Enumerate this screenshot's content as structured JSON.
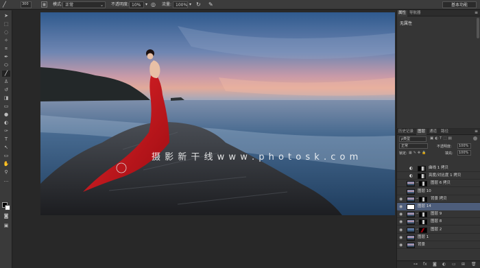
{
  "options_bar": {
    "brush_size": "300",
    "mode_label": "模式:",
    "mode_value": "正常",
    "opacity_label": "不透明度:",
    "opacity_value": "10%",
    "flow_label": "流量:",
    "flow_value": "100%",
    "workspace": "基本功能"
  },
  "watermark": "摄 影 新 干 线   w w w . p h o t o s k . c o m",
  "properties_panel": {
    "tabs": [
      "属性",
      "导航器"
    ],
    "content": "无属性"
  },
  "layers_panel": {
    "tabs": [
      "历史记录",
      "图层",
      "通道",
      "路径"
    ],
    "filter_kind": "ρ类型",
    "blend_mode": "正常",
    "opacity_label": "不透明度:",
    "opacity_value": "100%",
    "lock_label": "锁定:",
    "fill_label": "填充:",
    "fill_value": "100%",
    "layers": [
      {
        "name": "曲线 1 拷贝",
        "visible": false,
        "type": "adjust",
        "selected": false
      },
      {
        "name": "亮度/对比度 1 拷贝",
        "visible": false,
        "type": "adjust",
        "selected": false
      },
      {
        "name": "图层 6 拷贝",
        "visible": false,
        "type": "mask",
        "selected": false
      },
      {
        "name": "图层 10",
        "visible": false,
        "type": "photo",
        "selected": false
      },
      {
        "name": "背景 拷贝",
        "visible": true,
        "type": "mask",
        "selected": false
      },
      {
        "name": "图层 14",
        "visible": true,
        "type": "white",
        "selected": true
      },
      {
        "name": "图层 9",
        "visible": true,
        "type": "mask",
        "selected": false
      },
      {
        "name": "图层 8",
        "visible": true,
        "type": "mask",
        "selected": false
      },
      {
        "name": "图层 2",
        "visible": true,
        "type": "red",
        "selected": false
      },
      {
        "name": "图层 1",
        "visible": true,
        "type": "photo",
        "selected": false
      },
      {
        "name": "背景",
        "visible": true,
        "type": "photo",
        "selected": false
      }
    ]
  },
  "colors": {
    "panel_bg": "#353535",
    "selection": "#4d5d7b",
    "dress_red": "#d3141c"
  }
}
